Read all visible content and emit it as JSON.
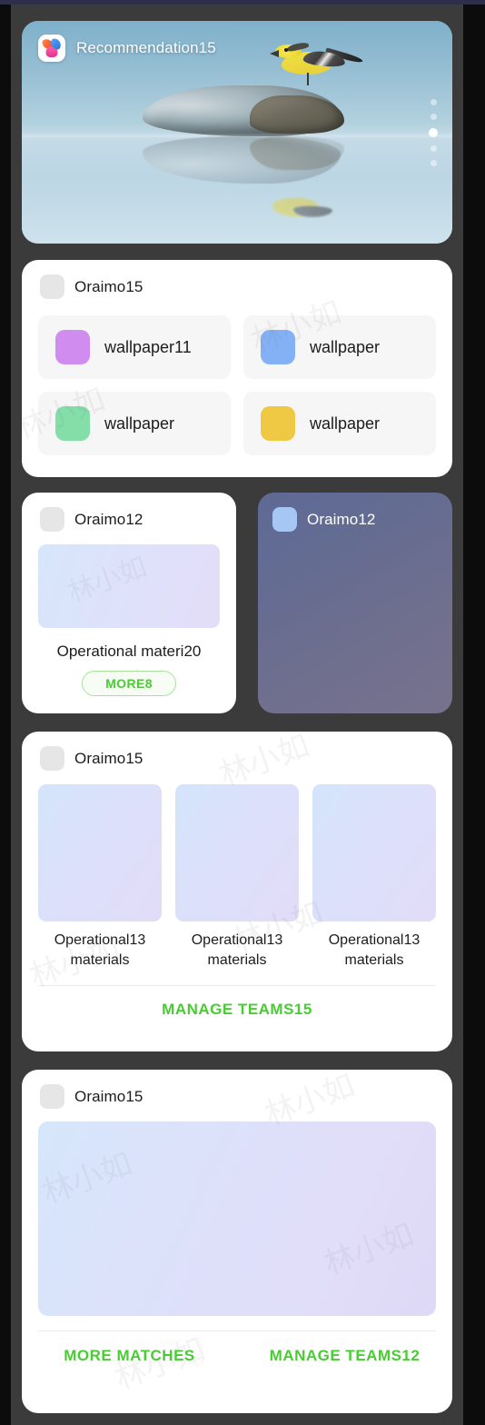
{
  "theme": {
    "page_background": "#3b3b3b",
    "card_background": "#ffffff",
    "accent_green": "#49cc33",
    "dark_card_gradient_start": "#5e6a95",
    "dark_card_gradient_end": "#77728e"
  },
  "hero": {
    "app_icon": "app-logo-icon",
    "title": "Recommendation15",
    "image": "bird-on-rock-photo",
    "pager": {
      "count": 5,
      "active_index": 2
    }
  },
  "wallpapers_card": {
    "icon": "placeholder-icon",
    "title": "Oraimo15",
    "items": [
      {
        "label": "wallpaper11",
        "color": "#d18cf0"
      },
      {
        "label": "wallpaper",
        "color": "#84b1f5"
      },
      {
        "label": "wallpaper",
        "color": "#83dea8"
      },
      {
        "label": "wallpaper",
        "color": "#efc944"
      }
    ]
  },
  "material_card": {
    "icon": "placeholder-icon",
    "title": "Oraimo12",
    "thumbnail": "gradient-thumbnail",
    "caption": "Operational materi20",
    "more_label": "MORE8"
  },
  "dark_card": {
    "icon": "placeholder-icon",
    "title": "Oraimo12"
  },
  "triple_card": {
    "icon": "placeholder-icon",
    "title": "Oraimo15",
    "items": [
      {
        "label": "Operational13 materials",
        "thumbnail": "gradient-thumbnail"
      },
      {
        "label": "Operational13 materials",
        "thumbnail": "gradient-thumbnail"
      },
      {
        "label": "Operational13 materials",
        "thumbnail": "gradient-thumbnail"
      }
    ],
    "cta": "MANAGE TEAMS15"
  },
  "banner_card": {
    "icon": "placeholder-icon",
    "title": "Oraimo15",
    "thumbnail": "gradient-banner",
    "actions": [
      {
        "label": "MORE MATCHES"
      },
      {
        "label": "MANAGE TEAMS12"
      }
    ]
  },
  "watermark": {
    "text": "林小如"
  }
}
